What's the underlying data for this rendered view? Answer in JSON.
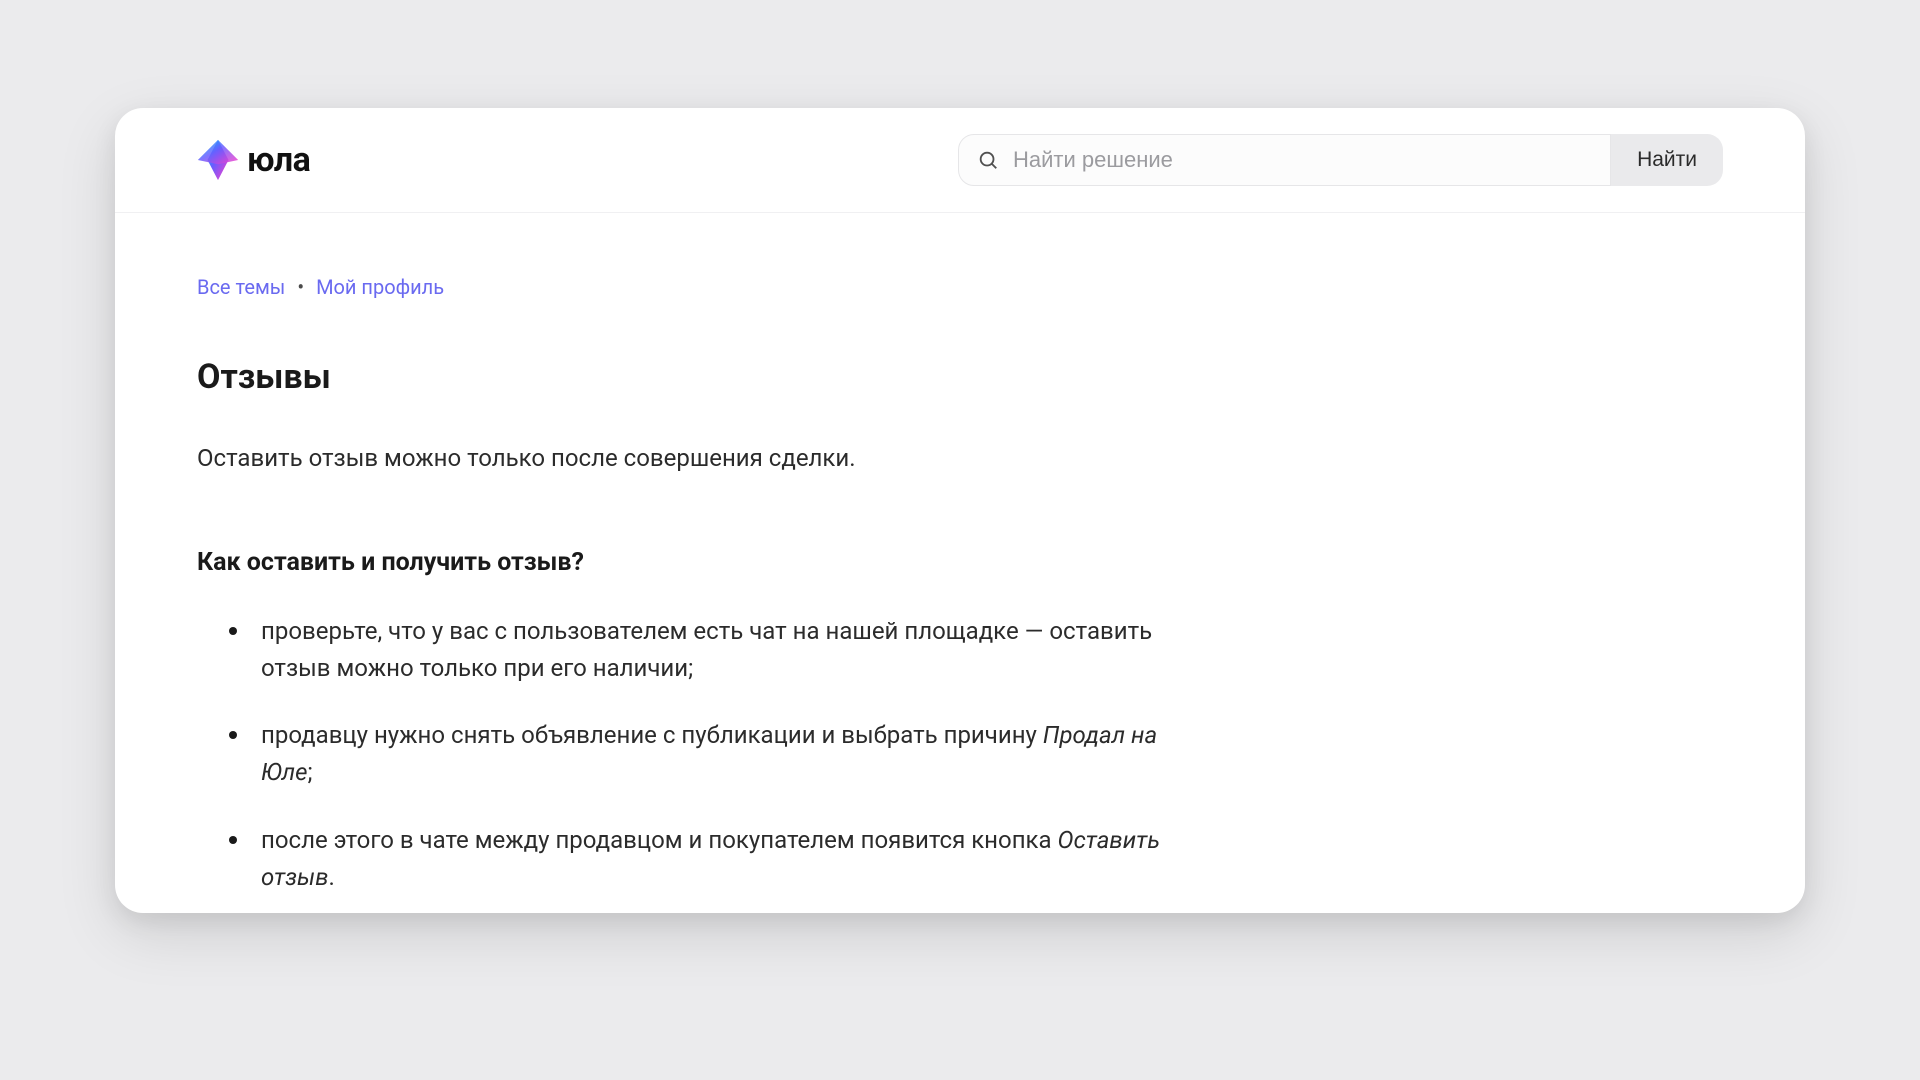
{
  "header": {
    "logo_text": "юла",
    "search": {
      "placeholder": "Найти решение",
      "button_label": "Найти"
    }
  },
  "breadcrumb": {
    "items": [
      {
        "label": "Все темы"
      },
      {
        "label": "Мой профиль"
      }
    ],
    "separator": "•"
  },
  "page": {
    "title": "Отзывы",
    "intro": "Оставить отзыв можно только после совершения сделки.",
    "section_title": "Как оставить и получить отзыв?",
    "bullets": [
      {
        "text_a": "проверьте, что у вас с пользователем есть чат на нашей площадке — оставить отзыв можно только при его наличии;",
        "italic": "",
        "tail": ""
      },
      {
        "text_a": "продавцу нужно снять объявление с публикации и выбрать причину ",
        "italic": "Продал на Юле",
        "tail": ";"
      },
      {
        "text_a": "после этого в чате между продавцом и покупателем появится кнопка ",
        "italic": "Оставить отзыв",
        "tail": "."
      }
    ]
  }
}
